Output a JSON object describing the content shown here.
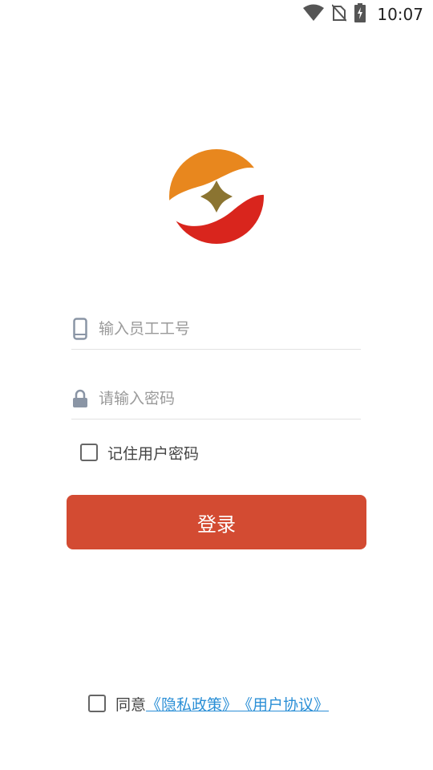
{
  "status_bar": {
    "time": "10:07",
    "icons": [
      "wifi-icon",
      "no-sim-icon",
      "battery-charging-icon"
    ]
  },
  "logo": {
    "icon": "coin-logo-icon",
    "colors": {
      "orange": "#e8871e",
      "red": "#d9251d",
      "diamond": "#8b7431"
    }
  },
  "login_form": {
    "employee_id": {
      "icon": "phone-icon",
      "placeholder": "输入员工工号",
      "value": ""
    },
    "password": {
      "icon": "lock-icon",
      "placeholder": "请输入密码",
      "value": ""
    },
    "remember": {
      "label": "记住用户密码",
      "checked": false
    },
    "submit_label": "登录"
  },
  "agreement": {
    "prefix": "同意",
    "links": [
      "《隐私政策》",
      "《用户协议》"
    ],
    "checked": false
  },
  "colors": {
    "primary_button": "#d34b32",
    "link": "#2b8fd6"
  }
}
